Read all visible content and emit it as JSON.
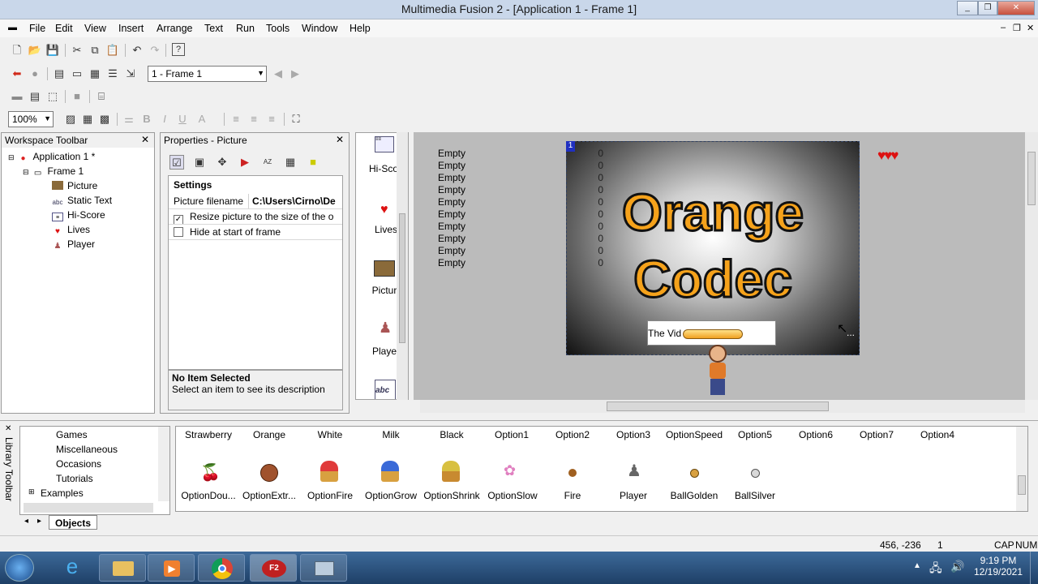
{
  "window": {
    "title": "Multimedia Fusion 2 - [Application 1 - Frame 1]"
  },
  "menu": [
    "File",
    "Edit",
    "View",
    "Insert",
    "Arrange",
    "Text",
    "Run",
    "Tools",
    "Window",
    "Help"
  ],
  "toolbar": {
    "frame_select": "1 - Frame 1",
    "zoom": "100%"
  },
  "workspace": {
    "title": "Workspace Toolbar",
    "app": "Application 1 *",
    "frame": "Frame 1",
    "objects": [
      "Picture",
      "Static Text",
      "Hi-Score",
      "Lives",
      "Player"
    ]
  },
  "properties": {
    "title": "Properties - Picture",
    "section": "Settings",
    "filename_label": "Picture filename",
    "filename_value": "C:\\Users\\Cirno\\De",
    "resize_label": "Resize picture to the size of the o",
    "hide_label": "Hide at start of frame",
    "no_item_title": "No Item Selected",
    "no_item_desc": "Select an item to see its description"
  },
  "object_strip": [
    "Hi-Sco",
    "Lives",
    "Pictur",
    "Playe"
  ],
  "frame": {
    "hiscores": [
      "Empty",
      "Empty",
      "Empty",
      "Empty",
      "Empty",
      "Empty",
      "Empty",
      "Empty",
      "Empty",
      "Empty"
    ],
    "scores": [
      "0",
      "0",
      "0",
      "0",
      "0",
      "0",
      "0",
      "0",
      "0",
      "0"
    ],
    "logo_line1": "Orange",
    "logo_line2": "Codec",
    "text_box": "The Vid",
    "layer_tag": "1",
    "cursor_dots": "..."
  },
  "library": {
    "title": "Library Toolbar",
    "tree": [
      "Games",
      "Miscellaneous",
      "Occasions",
      "Tutorials",
      "Examples"
    ],
    "tab": "Objects",
    "row1": [
      "Strawberry",
      "Orange",
      "White",
      "Milk",
      "Black",
      "Option1",
      "Option2",
      "Option3",
      "OptionSpeed",
      "Option5",
      "Option6",
      "Option7",
      "Option4"
    ],
    "row2": [
      "OptionDou...",
      "OptionExtr...",
      "OptionFire",
      "OptionGrow",
      "OptionShrink",
      "OptionSlow",
      "Fire",
      "Player",
      "BallGolden",
      "BallSilver"
    ]
  },
  "status": {
    "coords": "456, -236",
    "frame_num": "1",
    "cap": "CAP",
    "num": "NUM"
  },
  "taskbar": {
    "time": "9:19 PM",
    "date": "12/19/2021"
  },
  "colors": {
    "accent_orange": "#f5a21b",
    "title_blue": "#c9d7ea",
    "taskbar": "#2a4f7c"
  }
}
